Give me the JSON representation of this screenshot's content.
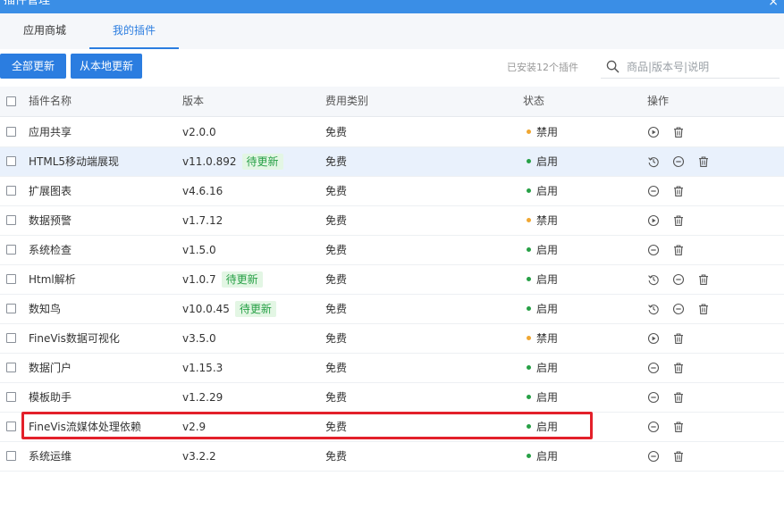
{
  "window": {
    "title": "插件管理",
    "close_glyph": "×"
  },
  "tabs": [
    {
      "label": "应用商城",
      "active": false
    },
    {
      "label": "我的插件",
      "active": true
    }
  ],
  "toolbar": {
    "update_all": "全部更新",
    "update_local": "从本地更新",
    "installed_text": "已安装12个插件"
  },
  "search": {
    "placeholder": "商品|版本号|说明",
    "value": ""
  },
  "table": {
    "headers": {
      "name": "插件名称",
      "version": "版本",
      "fee": "费用类别",
      "status": "状态",
      "actions": "操作"
    },
    "rows": [
      {
        "name": "应用共享",
        "version": "v2.0.0",
        "badge": "",
        "fee": "免费",
        "status": "禁用",
        "status_color": "#f0a732",
        "actions": [
          "enable-icon",
          "delete-icon"
        ],
        "highlight": false
      },
      {
        "name": "HTML5移动端展现",
        "version": "v11.0.892",
        "badge": "待更新",
        "fee": "免费",
        "status": "启用",
        "status_color": "#27a046",
        "actions": [
          "update-icon",
          "disable-icon",
          "delete-icon"
        ],
        "highlight": true
      },
      {
        "name": "扩展图表",
        "version": "v4.6.16",
        "badge": "",
        "fee": "免费",
        "status": "启用",
        "status_color": "#27a046",
        "actions": [
          "disable-icon",
          "delete-icon"
        ],
        "highlight": false
      },
      {
        "name": "数据预警",
        "version": "v1.7.12",
        "badge": "",
        "fee": "免费",
        "status": "禁用",
        "status_color": "#f0a732",
        "actions": [
          "enable-icon",
          "delete-icon"
        ],
        "highlight": false
      },
      {
        "name": "系统检查",
        "version": "v1.5.0",
        "badge": "",
        "fee": "免费",
        "status": "启用",
        "status_color": "#27a046",
        "actions": [
          "disable-icon",
          "delete-icon"
        ],
        "highlight": false
      },
      {
        "name": "Html解析",
        "version": "v1.0.7",
        "badge": "待更新",
        "fee": "免费",
        "status": "启用",
        "status_color": "#27a046",
        "actions": [
          "update-icon",
          "disable-icon",
          "delete-icon"
        ],
        "highlight": false
      },
      {
        "name": "数知鸟",
        "version": "v10.0.45",
        "badge": "待更新",
        "fee": "免费",
        "status": "启用",
        "status_color": "#27a046",
        "actions": [
          "update-icon",
          "disable-icon",
          "delete-icon"
        ],
        "highlight": false
      },
      {
        "name": "FineVis数据可视化",
        "version": "v3.5.0",
        "badge": "",
        "fee": "免费",
        "status": "禁用",
        "status_color": "#f0a732",
        "actions": [
          "enable-icon",
          "delete-icon"
        ],
        "highlight": false
      },
      {
        "name": "数据门户",
        "version": "v1.15.3",
        "badge": "",
        "fee": "免费",
        "status": "启用",
        "status_color": "#27a046",
        "actions": [
          "disable-icon",
          "delete-icon"
        ],
        "highlight": false
      },
      {
        "name": "模板助手",
        "version": "v1.2.29",
        "badge": "",
        "fee": "免费",
        "status": "启用",
        "status_color": "#27a046",
        "actions": [
          "disable-icon",
          "delete-icon"
        ],
        "highlight": false
      },
      {
        "name": "FineVis流媒体处理依赖",
        "version": "v2.9",
        "badge": "",
        "fee": "免费",
        "status": "启用",
        "status_color": "#27a046",
        "actions": [
          "disable-icon",
          "delete-icon"
        ],
        "highlight": false
      },
      {
        "name": "系统运维",
        "version": "v3.2.2",
        "badge": "",
        "fee": "免费",
        "status": "启用",
        "status_color": "#27a046",
        "actions": [
          "disable-icon",
          "delete-icon"
        ],
        "highlight": false
      }
    ]
  },
  "colors": {
    "accent": "#2b7de0",
    "titlebar": "#3a8ee6",
    "enabled": "#27a046",
    "disabled": "#f0a732",
    "annotation": "#e3202a"
  }
}
